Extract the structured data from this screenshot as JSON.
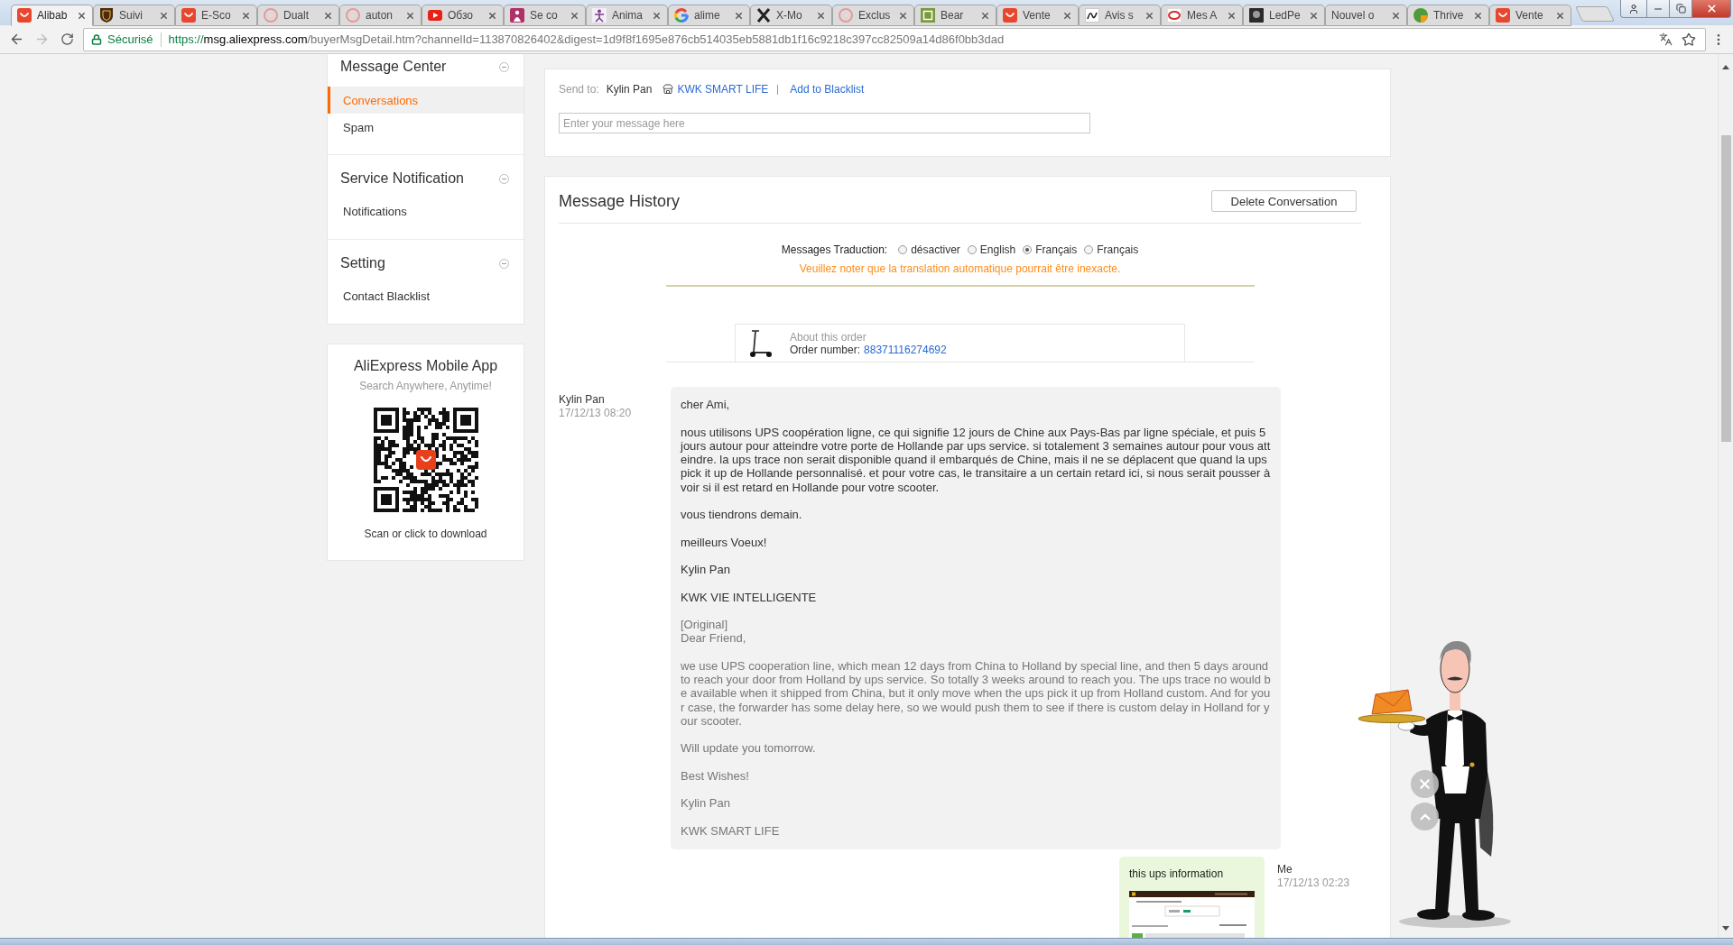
{
  "browser_tabs": [
    {
      "title": "Alibab",
      "kind": "bag",
      "selected": true
    },
    {
      "title": "Suivi",
      "kind": "shield",
      "selected": false
    },
    {
      "title": "E-Sco",
      "kind": "bag",
      "selected": false
    },
    {
      "title": "Dualt",
      "kind": "ring",
      "selected": false
    },
    {
      "title": "auton",
      "kind": "ring",
      "selected": false
    },
    {
      "title": "Обзо",
      "kind": "play",
      "selected": false
    },
    {
      "title": "Se co",
      "kind": "figure",
      "selected": false
    },
    {
      "title": "Anima",
      "kind": "dancer",
      "selected": false
    },
    {
      "title": "alime",
      "kind": "google",
      "selected": false
    },
    {
      "title": "X-Mo",
      "kind": "cross",
      "selected": false
    },
    {
      "title": "Exclus",
      "kind": "ring",
      "selected": false
    },
    {
      "title": "Bear",
      "kind": "frame",
      "selected": false
    },
    {
      "title": "Vente",
      "kind": "bag",
      "selected": false
    },
    {
      "title": "Avis s",
      "kind": "squiggle",
      "selected": false
    },
    {
      "title": "Mes A",
      "kind": "oval",
      "selected": false
    },
    {
      "title": "LedPe",
      "kind": "photo",
      "selected": false
    },
    {
      "title": "Nouvel o",
      "kind": "blank",
      "selected": false
    },
    {
      "title": "Thrive",
      "kind": "pie",
      "selected": false
    },
    {
      "title": "Vente",
      "kind": "bag",
      "selected": false
    }
  ],
  "address_bar": {
    "security": "Sécurisé",
    "url": {
      "scheme": "https://",
      "host": "msg.aliexpress.com",
      "path": "/buyerMsgDetail.htm?channelId=113870826402&digest=1d9f8f1695e876cb514035eb5881db1f16c9218c397cc82509a14d86f0bb3dad"
    }
  },
  "sidebar": {
    "sections": [
      {
        "title": "Message Center",
        "expanded": true,
        "items": [
          {
            "label": "Conversations",
            "selected": true
          },
          {
            "label": "Spam",
            "selected": false
          }
        ]
      },
      {
        "title": "Service Notification",
        "expanded": true,
        "items": [
          {
            "label": "Notifications",
            "selected": false
          }
        ]
      },
      {
        "title": "Setting",
        "expanded": true,
        "items": [
          {
            "label": "Contact Blacklist",
            "selected": false
          }
        ]
      }
    ],
    "app_promo": {
      "title": "AliExpress Mobile App",
      "subtitle": "Search Anywhere, Anytime!",
      "caption": "Scan or click to download"
    }
  },
  "compose": {
    "send_to_label": "Send to:",
    "recipient": "Kylin Pan",
    "store": "KWK SMART LIFE",
    "blacklist_link": "Add to Blacklist",
    "placeholder": "Enter your message here"
  },
  "history": {
    "title": "Message History",
    "delete_button": "Delete Conversation",
    "translation": {
      "label": "Messages Traduction:",
      "options": [
        {
          "label": "désactiver",
          "selected": false
        },
        {
          "label": "English",
          "selected": false
        },
        {
          "label": "Français",
          "selected": true
        },
        {
          "label": "Français",
          "selected": false
        }
      ],
      "note": "Veuillez noter que la translation automatique pourrait être inexacte."
    },
    "order": {
      "caption": "About this order",
      "number_label": "Order number:",
      "number": "88371116274692"
    },
    "messages": [
      {
        "kind": "received",
        "sender": "Kylin Pan",
        "time": "17/12/13 08:20",
        "paragraphs": [
          "cher Ami,",
          "nous utilisons UPS coopération ligne, ce qui signifie 12 jours de Chine aux Pays-Bas par ligne spéciale, et puis 5 jours autour pour atteindre votre porte de Hollande par ups service. si totalement 3 semaines autour pour vous atteindre. la ups trace non serait disponible quand il embarqués de Chine, mais il ne se déplacent que quand la ups pick it up de Hollande personnalisé. et pour votre cas, le transitaire a un certain retard ici, si nous serait pousser à voir si il est retard en Hollande pour votre scooter.",
          "vous tiendrons demain.",
          "meilleurs Voeux!",
          "Kylin Pan",
          "KWK VIE INTELLIGENTE"
        ],
        "original": {
          "label": "[Original]",
          "paragraphs": [
            "Dear Friend,",
            "we use UPS cooperation line, which mean 12 days from China to Holland by special line, and then 5 days around to reach your door from Holland by ups service. So totally 3 weeks around to reach you. The ups trace no would be available when it shipped from China, but it only move when the ups pick it up from Holland custom. And for your case, the forwarder has some delay here, so we would push them to see if there is custom delay in Holland for your scooter.",
            "Will update you tomorrow.",
            "Best Wishes!",
            "Kylin Pan",
            "KWK SMART LIFE"
          ]
        }
      },
      {
        "kind": "sent",
        "sender": "Me",
        "time": "17/12/13 02:23",
        "paragraphs": [
          "this ups information"
        ],
        "attachment": true
      }
    ]
  }
}
